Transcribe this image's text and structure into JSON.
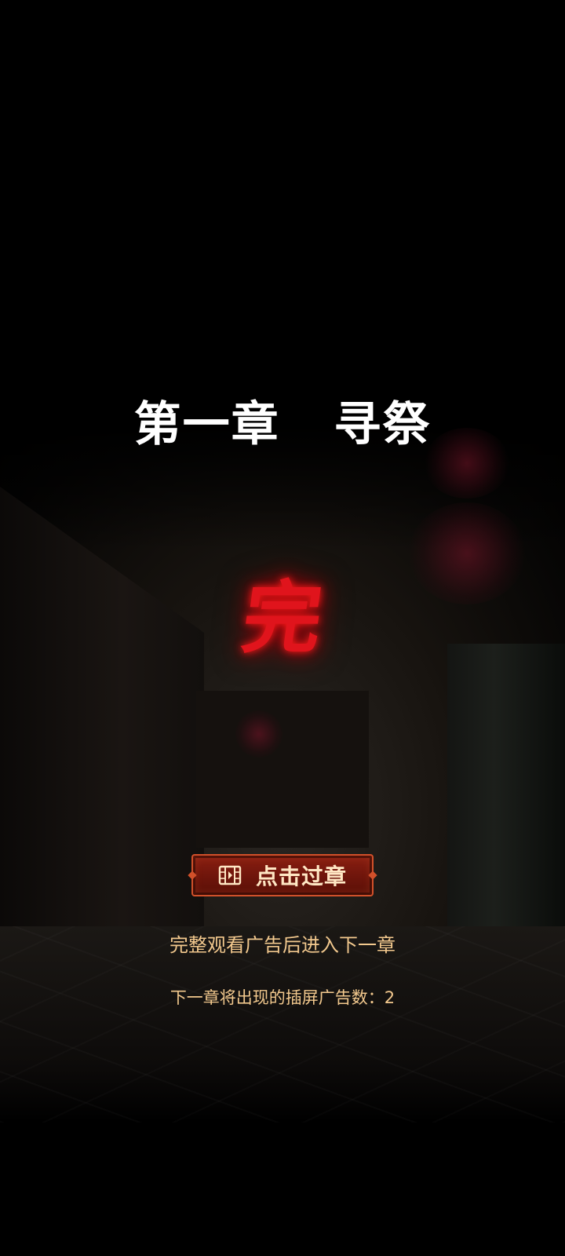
{
  "chapter": {
    "title": "第一章   寻祭"
  },
  "status": {
    "end_mark": "完"
  },
  "skip_button": {
    "icon": "film-icon",
    "label": "点击过章"
  },
  "hint": {
    "text": "完整观看广告后进入下一章"
  },
  "ad_info": {
    "text": "下一章将出现的插屏广告数：2"
  },
  "colors": {
    "title": "#ffffff",
    "end_mark": "#e0141c",
    "button_bg": "#7a1a0e",
    "button_border": "#d1502a",
    "hint_text": "#f3c98e"
  }
}
